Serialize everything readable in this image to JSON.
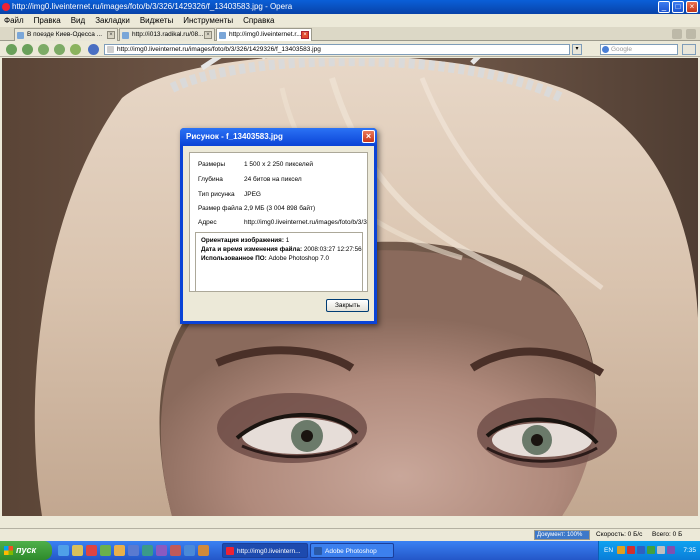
{
  "window": {
    "title": "http://img0.liveinternet.ru/images/foto/b/3/326/1429326/f_13403583.jpg - Opera"
  },
  "menu": [
    "Файл",
    "Правка",
    "Вид",
    "Закладки",
    "Виджеты",
    "Инструменты",
    "Справка"
  ],
  "tabs": [
    {
      "label": "В поезде Киев-Одесса ...",
      "active": false
    },
    {
      "label": "http://i013.radikal.ru/08...",
      "active": false
    },
    {
      "label": "http://img0.liveinternet.r...",
      "active": true
    }
  ],
  "address": {
    "url": "http://img0.liveinternet.ru/images/foto/b/3/326/1429326/f_13403583.jpg",
    "search_placeholder": "Google"
  },
  "dialog": {
    "title": "Рисунок - f_13403583.jpg",
    "properties": [
      {
        "key": "Размеры",
        "value": "1 500 x 2 250 пикселей"
      },
      {
        "key": "Глубина",
        "value": "24 битов на пиксел"
      },
      {
        "key": "Тип рисунка",
        "value": "JPEG"
      },
      {
        "key": "Размер файла",
        "value": "2,9 МБ (3 004 898 байт)"
      },
      {
        "key": "Адрес",
        "value": "http://img0.liveinternet.ru/images/foto/b/3/3"
      }
    ],
    "exif": [
      {
        "key": "Ориентация изображения:",
        "value": "1"
      },
      {
        "key": "Дата и время изменения файла:",
        "value": "2008:03:27 12:27:56"
      },
      {
        "key": "Использованное ПО:",
        "value": "Adobe Photoshop 7.0"
      }
    ],
    "close_label": "Закрыть"
  },
  "status": {
    "document_label": "Документ: 100%",
    "document_progress": 1.0,
    "speed": "Скорость: 0 Б/с",
    "total": "Всего: 0 Б"
  },
  "taskbar": {
    "start_label": "пуск",
    "tasks": [
      {
        "label": "http://img0.liveintern...",
        "active": true
      },
      {
        "label": "Adobe Photoshop",
        "active": false
      }
    ],
    "language": "EN",
    "clock": "7:35"
  },
  "colors": {
    "xp_blue": "#0a43d6",
    "tray_blue": "#0a7dd8",
    "start_green": "#2e8a2b"
  }
}
